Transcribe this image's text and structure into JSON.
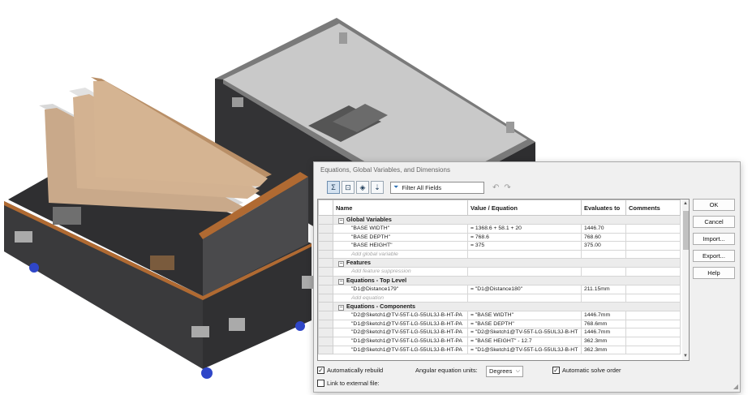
{
  "dialog": {
    "title": "Equations, Global Variables, and Dimensions",
    "filter_placeholder": "Filter All Fields",
    "toolbar_icons": [
      "equation-view-icon",
      "sketch-equation-view-icon",
      "dimension-view-icon",
      "ordered-view-icon"
    ],
    "columns": [
      "Name",
      "Value / Equation",
      "Evaluates to",
      "Comments"
    ],
    "sections": [
      {
        "title": "Global Variables",
        "rows": [
          {
            "name": "\"BASE WIDTH\"",
            "value": "= 1368.6 + 58.1 + 20",
            "evaluates": "1446.70",
            "comment": ""
          },
          {
            "name": "\"BASE DEPTH\"",
            "value": "= 768.6",
            "evaluates": "768.60",
            "comment": ""
          },
          {
            "name": "\"BASE HEIGHT\"",
            "value": "= 375",
            "evaluates": "375.00",
            "comment": ""
          }
        ],
        "placeholder": "Add global variable"
      },
      {
        "title": "Features",
        "rows": [],
        "placeholder": "Add feature suppression"
      },
      {
        "title": "Equations - Top Level",
        "rows": [
          {
            "name": "\"D1@Distance179\"",
            "value": "= \"D1@Distance180\"",
            "evaluates": "211.15mm",
            "comment": ""
          }
        ],
        "placeholder": "Add equation"
      },
      {
        "title": "Equations - Components",
        "rows": [
          {
            "name": "\"D2@Sketch1@TV-55T-LG-55UL3J-B-HT-PA",
            "value": "= \"BASE WIDTH\"",
            "evaluates": "1446.7mm",
            "comment": ""
          },
          {
            "name": "\"D1@Sketch1@TV-55T-LG-55UL3J-B-HT-PA",
            "value": "= \"BASE DEPTH\"",
            "evaluates": "768.6mm",
            "comment": ""
          },
          {
            "name": "\"D2@Sketch1@TV-55T-LG-55UL3J-B-HT-PA",
            "value": "= \"D2@Sketch1@TV-55T-LG-55UL3J-B-HT",
            "evaluates": "1446.7mm",
            "comment": ""
          },
          {
            "name": "\"D1@Sketch1@TV-55T-LG-55UL3J-B-HT-PA",
            "value": "= \"BASE HEIGHT\" - 12.7",
            "evaluates": "362.3mm",
            "comment": ""
          },
          {
            "name": "\"D1@Sketch1@TV-55T-LG-55UL3J-B-HT-PA",
            "value": "= \"D1@Sketch1@TV-55T-LG-55UL3J-B-HT",
            "evaluates": "362.3mm",
            "comment": ""
          }
        ],
        "placeholder": ""
      }
    ],
    "buttons": {
      "ok": "OK",
      "cancel": "Cancel",
      "import": "Import...",
      "export": "Export...",
      "help": "Help"
    },
    "options": {
      "auto_rebuild": {
        "label": "Automatically rebuild",
        "checked": true
      },
      "angular_units_label": "Angular equation units:",
      "angular_units_value": "Degrees",
      "auto_solve": {
        "label": "Automatic solve order",
        "checked": true
      },
      "link_external": {
        "label": "Link to external file:",
        "checked": false
      }
    }
  },
  "colors": {
    "case_body": "#3a3a3c",
    "case_edge": "#b06a32",
    "panel": "#c9a98a",
    "caster": "#2f46c8"
  }
}
